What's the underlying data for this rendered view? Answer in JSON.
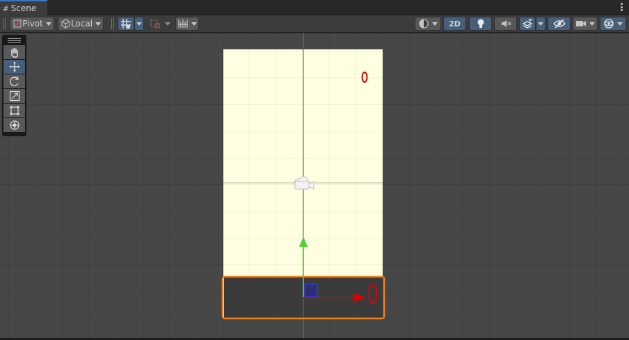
{
  "window": {
    "tab_title": "Scene",
    "tab_icon": "grid-hash-icon",
    "menu_icon": "kebab-menu-icon"
  },
  "toolbar": {
    "pivot_label": "Pivot",
    "local_label": "Local",
    "mode_2d_label": "2D",
    "accent_color": "#46607c"
  },
  "tools": [
    {
      "name": "hand-tool",
      "icon": "hand-icon",
      "active": false
    },
    {
      "name": "move-tool",
      "icon": "move-arrows-icon",
      "active": true
    },
    {
      "name": "rotate-tool",
      "icon": "rotate-icon",
      "active": false
    },
    {
      "name": "scale-tool",
      "icon": "scale-icon",
      "active": false
    },
    {
      "name": "rect-tool",
      "icon": "rect-transform-icon",
      "active": false
    },
    {
      "name": "transform-tool",
      "icon": "transform-icon",
      "active": false
    }
  ],
  "scene": {
    "background_color": "#474747",
    "canvas_color": "#fefee0",
    "selection_color": "#f7801a",
    "x_axis_color": "#e00000",
    "y_axis_color": "#4fd33a",
    "selected_object_fill": "#3b3b3b"
  }
}
